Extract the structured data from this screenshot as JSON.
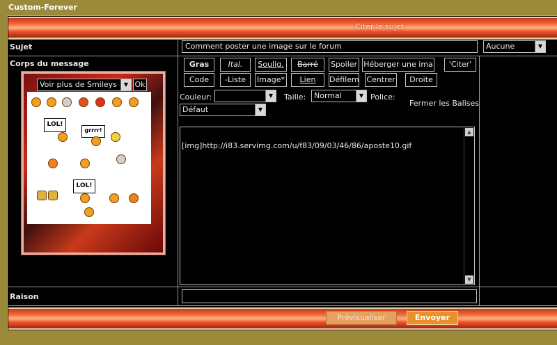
{
  "site_title": "Custom-Forever",
  "banner_title": "Citer le sujet",
  "subject": {
    "label": "Sujet",
    "value": "Comment poster une image sur le forum",
    "icon_select": "Aucune"
  },
  "body": {
    "label": "Corps du message"
  },
  "smileys": {
    "more_label": "Voir plus de Smileys",
    "ok_label": "Ok",
    "sign_1": "LOL!",
    "sign_2": "grrrr!",
    "sign_3": "LOL!"
  },
  "toolbar": {
    "bold": "Gras",
    "italic": "Ital.",
    "underline": "Soulig.",
    "strike": "Barré",
    "spoiler": "Spoiler",
    "host_image": "Héberger une ima",
    "quote": "'Citer'",
    "code": "Code",
    "list": "-Liste",
    "image": "Image*",
    "link": "Lien",
    "marquee": "Défilem",
    "center": "Centrer",
    "right": "Droite"
  },
  "formatting": {
    "color_label": "Couleur:",
    "color_value": "",
    "size_label": "Taille:",
    "size_value": "Normal",
    "font_label": "Police:",
    "close_tags": "Fermer les Balises",
    "font_value": "Défaut"
  },
  "message_text": "[img]http://i83.servimg.com/u/f83/09/03/46/86/aposte10.gif",
  "reason": {
    "label": "Raison",
    "value": ""
  },
  "actions": {
    "preview": "Prévisualiser",
    "send": "Envoyer"
  },
  "colors": {
    "accent": "#e8902a",
    "frame_bg": "#000000",
    "page_bg": "#9b8a3a"
  }
}
